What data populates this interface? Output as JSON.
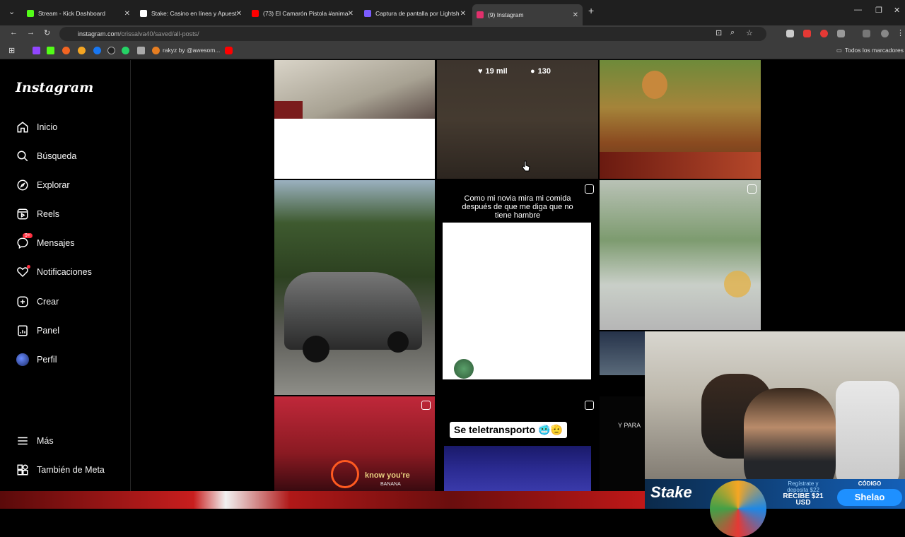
{
  "browser": {
    "tabs": [
      {
        "title": "Stream - Kick Dashboard",
        "color": "#53fc18"
      },
      {
        "title": "Stake: Casino en línea y Apuest",
        "color": "#ffffff"
      },
      {
        "title": "(73) El Camarón Pistola #anima",
        "color": "#ff0000"
      },
      {
        "title": "Captura de pantalla por Lightsh",
        "color": "#7b5cff"
      },
      {
        "title": "(9) Instagram",
        "color": "#e1306c"
      }
    ],
    "url_domain": "instagram.com",
    "url_path": "/crissalva40/saved/all-posts/",
    "bookmark_label": "rakyz by @awesom...",
    "all_bookmarks": "Todos los marcadores"
  },
  "sidebar": {
    "logo": "Instagram",
    "items": [
      {
        "label": "Inicio",
        "icon": "home-icon"
      },
      {
        "label": "Búsqueda",
        "icon": "search-icon"
      },
      {
        "label": "Explorar",
        "icon": "compass-icon"
      },
      {
        "label": "Reels",
        "icon": "reels-icon"
      },
      {
        "label": "Mensajes",
        "icon": "messenger-icon",
        "badge": "9+"
      },
      {
        "label": "Notificaciones",
        "icon": "heart-icon"
      },
      {
        "label": "Crear",
        "icon": "plus-square-icon"
      },
      {
        "label": "Panel",
        "icon": "dashboard-icon"
      },
      {
        "label": "Perfil",
        "icon": "avatar-icon"
      }
    ],
    "more": "Más",
    "meta": "También de Meta"
  },
  "grid": {
    "hover_likes": "19 mil",
    "hover_comments": "130",
    "meme_caption": "Como mi novia mira mi comida después de que me diga que no tiene hambre",
    "teletransporto": "Se teletransporto 🥶🫡",
    "know_text": "know you're",
    "banana_text": "BANANA",
    "ypara_text": "Y PARA"
  },
  "stake": {
    "brand": "Stake",
    "promo_line1": "Regístrate y",
    "promo_line2": "deposita $22",
    "promo_line3": "RECIBE $21 USD",
    "code_label": "CÓDIGO",
    "code": "Shelao"
  }
}
